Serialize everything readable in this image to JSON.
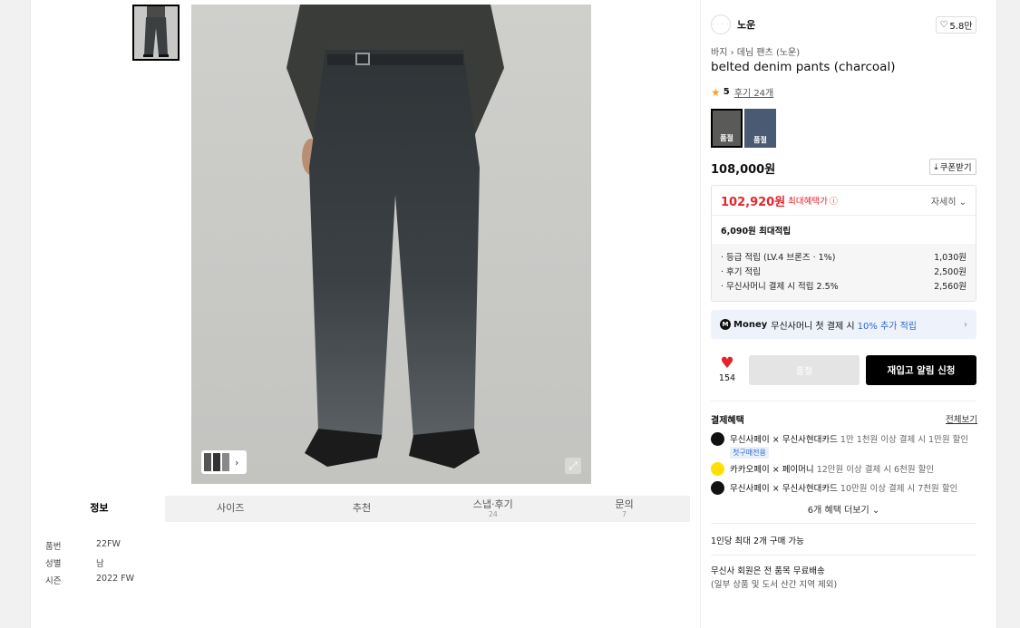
{
  "brand": {
    "logo_text": "· · · ·",
    "name": "노운",
    "likes": "5.8만"
  },
  "breadcrumb": [
    "바지",
    "데님 팬츠 (노운)"
  ],
  "product": {
    "title": "belted denim pants (charcoal)",
    "rating": "5",
    "reviews_link": "후기 24개",
    "price": "108,000원",
    "coupon_label": "쿠폰받기"
  },
  "swatches": [
    {
      "label": "품절",
      "color": "#5a5a58",
      "selected": true
    },
    {
      "label": "품절",
      "color": "#4a5a72",
      "selected": false
    }
  ],
  "benefit": {
    "max_price": "102,920원",
    "max_label": "최대혜택가",
    "detail_label": "자세히",
    "points_total": "6,090원 최대적립",
    "rows": [
      {
        "label": "· 등급 적립 (LV.4 브론즈 · 1%)",
        "value": "1,030원"
      },
      {
        "label": "· 후기 적립",
        "value": "2,500원"
      },
      {
        "label": "· 무신사머니 결제 시 적립 2.5%",
        "value": "2,560원"
      }
    ]
  },
  "money_banner": {
    "brand": "Money",
    "text": "무신사머니 첫 결제 시",
    "highlight": "10% 추가 적립"
  },
  "actions": {
    "like_count": "154",
    "soldout_label": "품절",
    "notify_label": "재입고 알림 신청"
  },
  "payment": {
    "heading": "결제혜택",
    "see_all": "전체보기",
    "items": [
      {
        "name": "무신사페이 × 무신사현대카드",
        "hint": "1만 1천원 이상 결제 시 1만원 할인",
        "tag": "첫구매전용"
      },
      {
        "name": "카카오페이 × 페이머니",
        "hint": "12만원 이상 결제 시 6천원 할인",
        "tag": ""
      },
      {
        "name": "무신사페이 × 무신사현대카드",
        "hint": "10만원 이상 결제 시 7천원 할인",
        "tag": ""
      }
    ],
    "more_label": "6개 혜택 더보기"
  },
  "purchase_limit": "1인당 최대 2개 구매 가능",
  "shipping": {
    "line1": "무신사 회원은 전 품목 무료배송",
    "line2": "(일부 상품 및 도서 산간 지역 제외)"
  },
  "tabs": [
    {
      "label": "정보",
      "sub": ""
    },
    {
      "label": "사이즈",
      "sub": ""
    },
    {
      "label": "추천",
      "sub": ""
    },
    {
      "label": "스냅·후기",
      "sub": "24"
    },
    {
      "label": "문의",
      "sub": "7"
    }
  ],
  "info_rows": [
    {
      "key": "품번",
      "value": "22FW"
    },
    {
      "key": "성별",
      "value": "남"
    },
    {
      "key": "시즌",
      "value": "2022 FW"
    }
  ],
  "icons": {
    "heart": "heart-icon",
    "star": "star-icon",
    "info": "info-icon",
    "chevron": "chevron-icon",
    "download": "download-icon",
    "expand": "expand-icon"
  }
}
